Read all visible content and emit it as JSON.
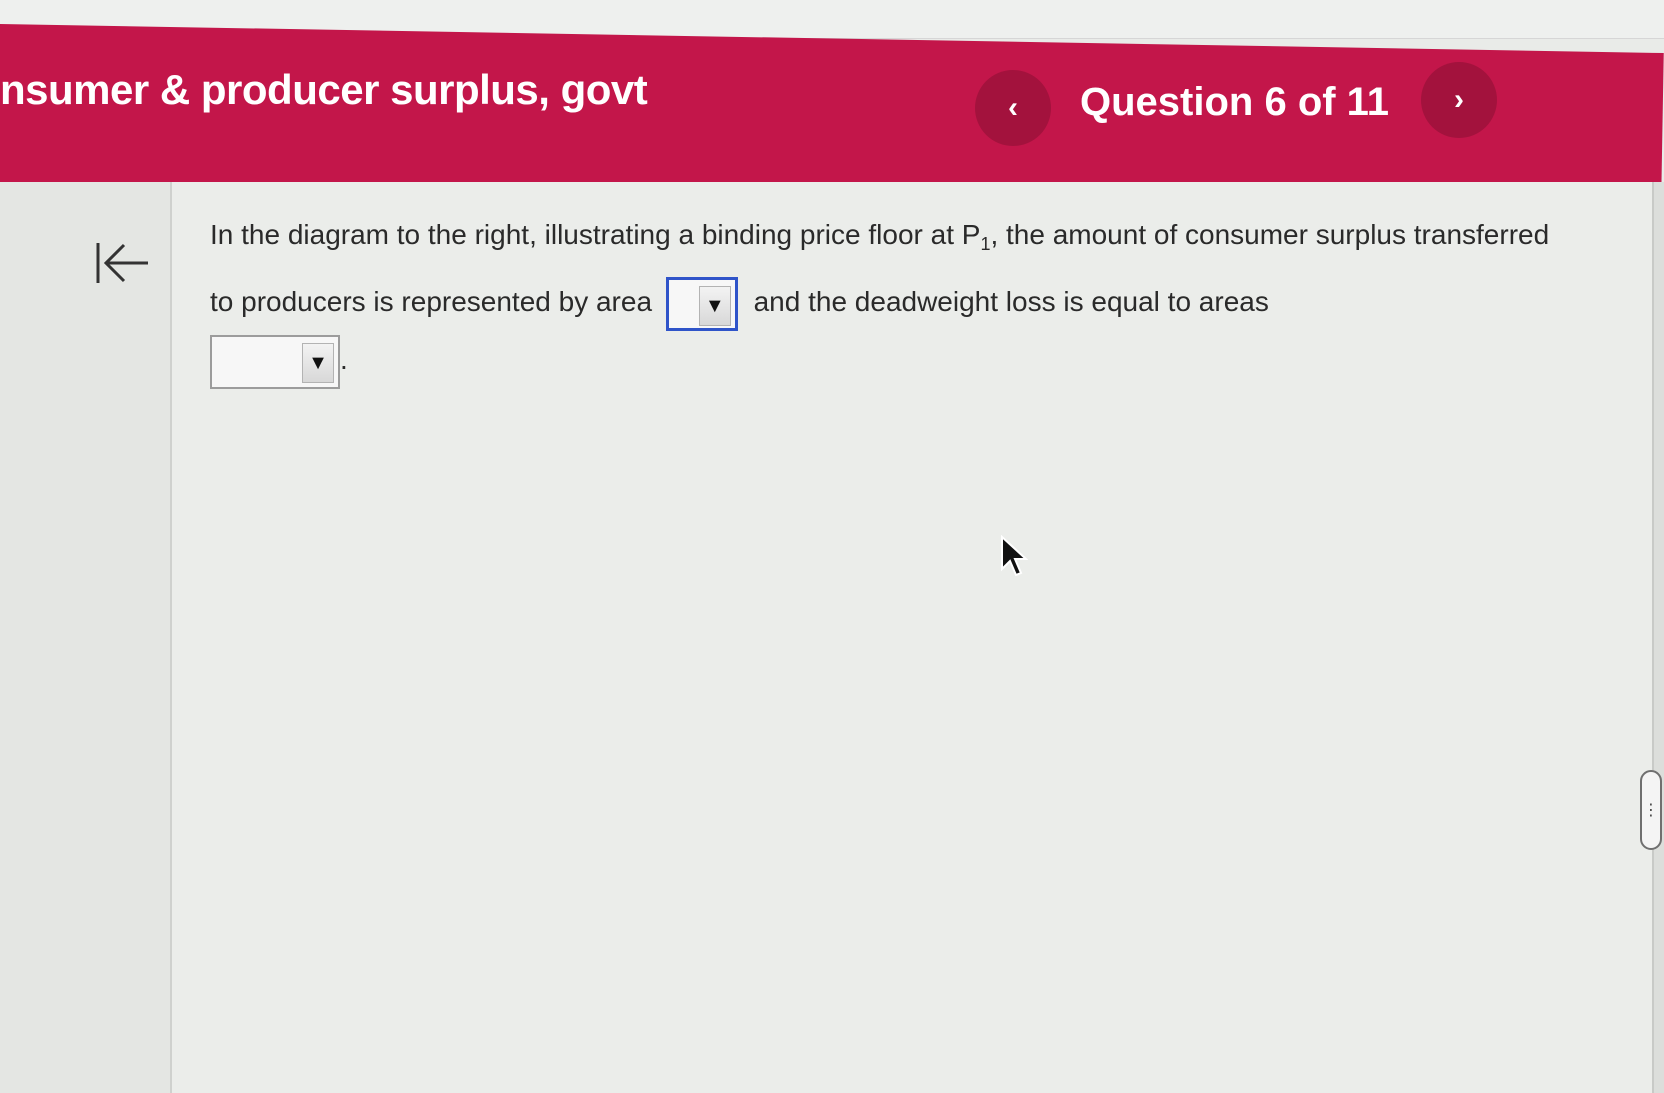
{
  "header": {
    "title": "nsumer & producer surplus, govt",
    "question_counter": "Question 6 of 11",
    "prev_label": "‹",
    "next_label": "›"
  },
  "question": {
    "part1": "In the diagram to the right, illustrating a binding price floor at P",
    "subscript": "1",
    "part2": ", the amount of consumer surplus transferred to producers is represented by area",
    "part3": "and the deadweight loss is equal to areas",
    "part4": ".",
    "dropdown1_value": "",
    "dropdown2_value": "",
    "dropdown_arrow": "▼"
  },
  "scroll_handle_label": "⋮",
  "colors": {
    "header": "#c3164a",
    "nav_button": "#a3123d",
    "active_dropdown_border": "#2f54c9"
  }
}
